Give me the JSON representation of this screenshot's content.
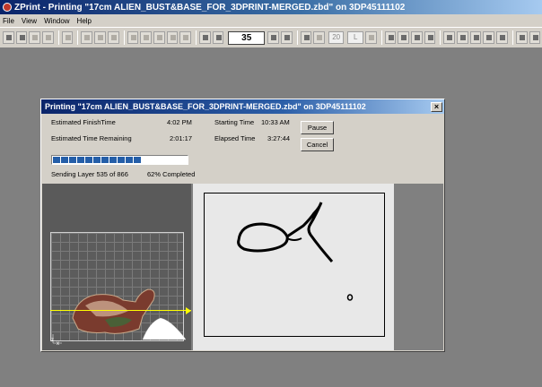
{
  "app": {
    "title": "ZPrint - Printing \"17cm ALIEN_BUST&BASE_FOR_3DPRINT-MERGED.zbd\" on 3DP45111102"
  },
  "menu": [
    "File",
    "View",
    "Window",
    "Help"
  ],
  "toolbar": {
    "layer_value": "35",
    "zoom_value": "20",
    "letter_value": "L"
  },
  "dialog": {
    "title": "Printing \"17cm ALIEN_BUST&BASE_FOR_3DPRINT-MERGED.zbd\" on 3DP45111102",
    "close_label": "×",
    "est_finish_label": "Estimated FinishTime",
    "est_finish_value": "4:02 PM",
    "est_remaining_label": "Estimated Time Remaining",
    "est_remaining_value": "2:01:17",
    "starting_time_label": "Starting Time",
    "starting_time_value": "10:33 AM",
    "elapsed_time_label": "Elapsed Time",
    "elapsed_time_value": "3:27:44",
    "sending_layer": "Sending Layer 535 of 866",
    "percent_completed": "62% Completed",
    "progress_fraction": 0.62,
    "pause_label": "Pause",
    "cancel_label": "Cancel"
  },
  "view3d": {
    "axis_z": "z",
    "axis_x": "x"
  },
  "colors": {
    "titlebar": "#0a246a",
    "progress": "#245ea8",
    "slice_line": "#ffff00"
  }
}
